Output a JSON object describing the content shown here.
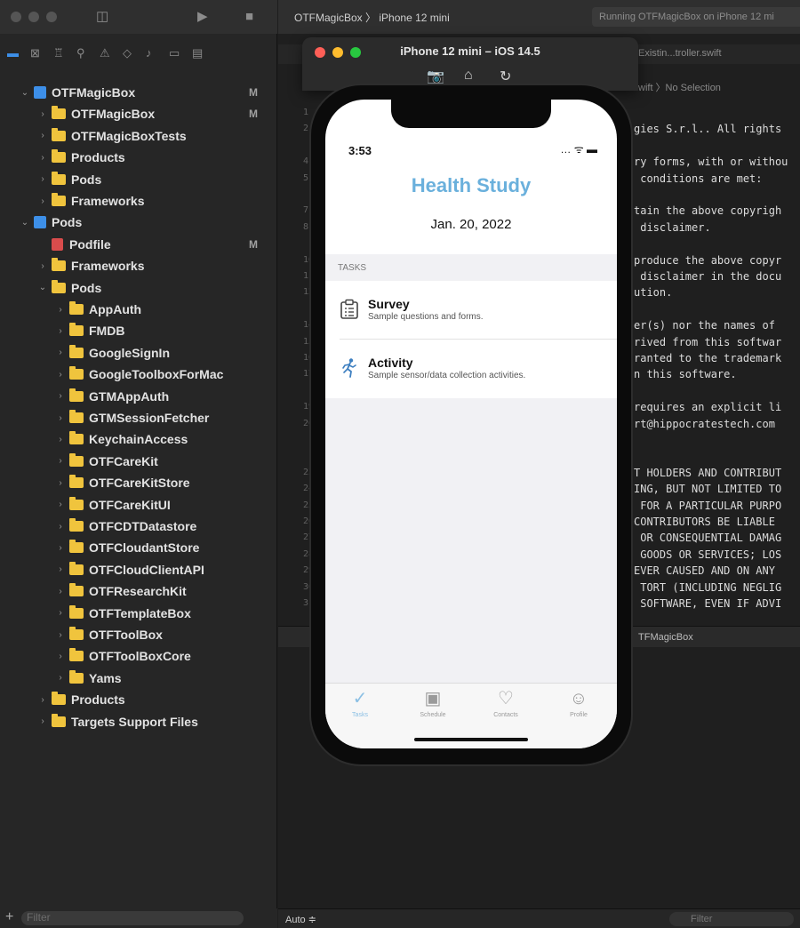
{
  "xcode": {
    "run_status": "Running OTFMagicBox on iPhone 12 mi",
    "breadcrumb": {
      "project": "OTFMagicBox",
      "device": "iPhone 12 mini"
    },
    "tab_file": "Existin...troller.swift",
    "jump_bar": "wift 〉No Selection",
    "debug_label": "TFMagicBox",
    "auto_label": "Auto ≑",
    "filter_placeholder": "Filter",
    "navigator_filter_placeholder": "Filter"
  },
  "navigator": {
    "rows": [
      {
        "label": "OTFMagicBox",
        "kind": "project",
        "level": 0,
        "open": true,
        "mark": "M"
      },
      {
        "label": "OTFMagicBox",
        "kind": "folder",
        "level": 1,
        "open": false,
        "mark": "M"
      },
      {
        "label": "OTFMagicBoxTests",
        "kind": "folder",
        "level": 1,
        "open": false,
        "mark": ""
      },
      {
        "label": "Products",
        "kind": "folder",
        "level": 1,
        "open": false,
        "mark": ""
      },
      {
        "label": "Pods",
        "kind": "folder",
        "level": 1,
        "open": false,
        "mark": ""
      },
      {
        "label": "Frameworks",
        "kind": "folder",
        "level": 1,
        "open": false,
        "mark": ""
      },
      {
        "label": "Pods",
        "kind": "project",
        "level": 0,
        "open": true,
        "mark": ""
      },
      {
        "label": "Podfile",
        "kind": "podfile",
        "level": 1,
        "open": null,
        "mark": "M"
      },
      {
        "label": "Frameworks",
        "kind": "folder",
        "level": 1,
        "open": false,
        "mark": ""
      },
      {
        "label": "Pods",
        "kind": "folder",
        "level": 1,
        "open": true,
        "mark": ""
      },
      {
        "label": "AppAuth",
        "kind": "folder",
        "level": 2,
        "open": false,
        "mark": ""
      },
      {
        "label": "FMDB",
        "kind": "folder",
        "level": 2,
        "open": false,
        "mark": ""
      },
      {
        "label": "GoogleSignIn",
        "kind": "folder",
        "level": 2,
        "open": false,
        "mark": ""
      },
      {
        "label": "GoogleToolboxForMac",
        "kind": "folder",
        "level": 2,
        "open": false,
        "mark": ""
      },
      {
        "label": "GTMAppAuth",
        "kind": "folder",
        "level": 2,
        "open": false,
        "mark": ""
      },
      {
        "label": "GTMSessionFetcher",
        "kind": "folder",
        "level": 2,
        "open": false,
        "mark": ""
      },
      {
        "label": "KeychainAccess",
        "kind": "folder",
        "level": 2,
        "open": false,
        "mark": ""
      },
      {
        "label": "OTFCareKit",
        "kind": "folder",
        "level": 2,
        "open": false,
        "mark": ""
      },
      {
        "label": "OTFCareKitStore",
        "kind": "folder",
        "level": 2,
        "open": false,
        "mark": ""
      },
      {
        "label": "OTFCareKitUI",
        "kind": "folder",
        "level": 2,
        "open": false,
        "mark": ""
      },
      {
        "label": "OTFCDTDatastore",
        "kind": "folder",
        "level": 2,
        "open": false,
        "mark": ""
      },
      {
        "label": "OTFCloudantStore",
        "kind": "folder",
        "level": 2,
        "open": false,
        "mark": ""
      },
      {
        "label": "OTFCloudClientAPI",
        "kind": "folder",
        "level": 2,
        "open": false,
        "mark": ""
      },
      {
        "label": "OTFResearchKit",
        "kind": "folder",
        "level": 2,
        "open": false,
        "mark": ""
      },
      {
        "label": "OTFTemplateBox",
        "kind": "folder",
        "level": 2,
        "open": false,
        "mark": ""
      },
      {
        "label": "OTFToolBox",
        "kind": "folder",
        "level": 2,
        "open": false,
        "mark": ""
      },
      {
        "label": "OTFToolBoxCore",
        "kind": "folder",
        "level": 2,
        "open": false,
        "mark": ""
      },
      {
        "label": "Yams",
        "kind": "folder",
        "level": 2,
        "open": false,
        "mark": ""
      },
      {
        "label": "Products",
        "kind": "folder",
        "level": 1,
        "open": false,
        "mark": ""
      },
      {
        "label": "Targets Support Files",
        "kind": "folder",
        "level": 1,
        "open": false,
        "mark": ""
      }
    ]
  },
  "code_lines": [
    {
      "line": 1,
      "text": "",
      "row": 0
    },
    {
      "line": 2,
      "text": "gies S.r.l.. All rights",
      "row": 1
    },
    {
      "line": 4,
      "text": "ry forms, with or withou",
      "row": 3
    },
    {
      "line": 5,
      "text": " conditions are met:",
      "row": 4
    },
    {
      "line": 7,
      "text": "tain the above copyrigh",
      "row": 6
    },
    {
      "line": 8,
      "text": " disclaimer.",
      "row": 7
    },
    {
      "line": 10,
      "text": "produce the above copyr",
      "row": 9
    },
    {
      "line": 11,
      "text": " disclaimer in the docu",
      "row": 10
    },
    {
      "line": 12,
      "text": "ution.",
      "row": 11
    },
    {
      "line": 14,
      "text": "er(s) nor the names of",
      "row": 13
    },
    {
      "line": 15,
      "text": "rived from this softwar",
      "row": 14
    },
    {
      "line": 16,
      "text": "ranted to the trademark",
      "row": 15
    },
    {
      "line": 17,
      "text": "n this software.",
      "row": 16
    },
    {
      "line": 19,
      "text": "requires an explicit li",
      "row": 18
    },
    {
      "line": 20,
      "text": "rt@hippocratestech.com",
      "row": 19
    },
    {
      "line": 23,
      "text": "T HOLDERS AND CONTRIBUT",
      "row": 22
    },
    {
      "line": 24,
      "text": "ING, BUT NOT LIMITED TO",
      "row": 23
    },
    {
      "line": 25,
      "text": " FOR A PARTICULAR PURPO",
      "row": 24
    },
    {
      "line": 26,
      "text": "CONTRIBUTORS BE LIABLE",
      "row": 25
    },
    {
      "line": 27,
      "text": " OR CONSEQUENTIAL DAMAG",
      "row": 26
    },
    {
      "line": 28,
      "text": " GOODS OR SERVICES; LOS",
      "row": 27
    },
    {
      "line": 29,
      "text": "EVER CAUSED AND ON ANY",
      "row": 28
    },
    {
      "line": 30,
      "text": " TORT (INCLUDING NEGLIG",
      "row": 29
    },
    {
      "line": 31,
      "text": " SOFTWARE, EVEN IF ADVI",
      "row": 30
    }
  ],
  "simulator": {
    "title": "iPhone 12 mini – iOS 14.5",
    "tools": {
      "screenshot": "📷",
      "home": "⌂",
      "rotate": "↻"
    }
  },
  "phone": {
    "time": "3:53",
    "status_icons": "… ᯤ ▬",
    "app_title": "Health Study",
    "date": "Jan. 20, 2022",
    "section_label": "TASKS",
    "tasks": [
      {
        "title": "Survey",
        "subtitle": "Sample questions and forms.",
        "icon": "clipboard-icon"
      },
      {
        "title": "Activity",
        "subtitle": "Sample sensor/data collection activities.",
        "icon": "running-figure-icon"
      }
    ],
    "tabs": [
      {
        "label": "Tasks",
        "icon": "✓",
        "active": true
      },
      {
        "label": "Schedule",
        "icon": "▣",
        "active": false
      },
      {
        "label": "Contacts",
        "icon": "♡",
        "active": false
      },
      {
        "label": "Profile",
        "icon": "☺",
        "active": false
      }
    ],
    "accent_color": "#6ab0dc"
  }
}
